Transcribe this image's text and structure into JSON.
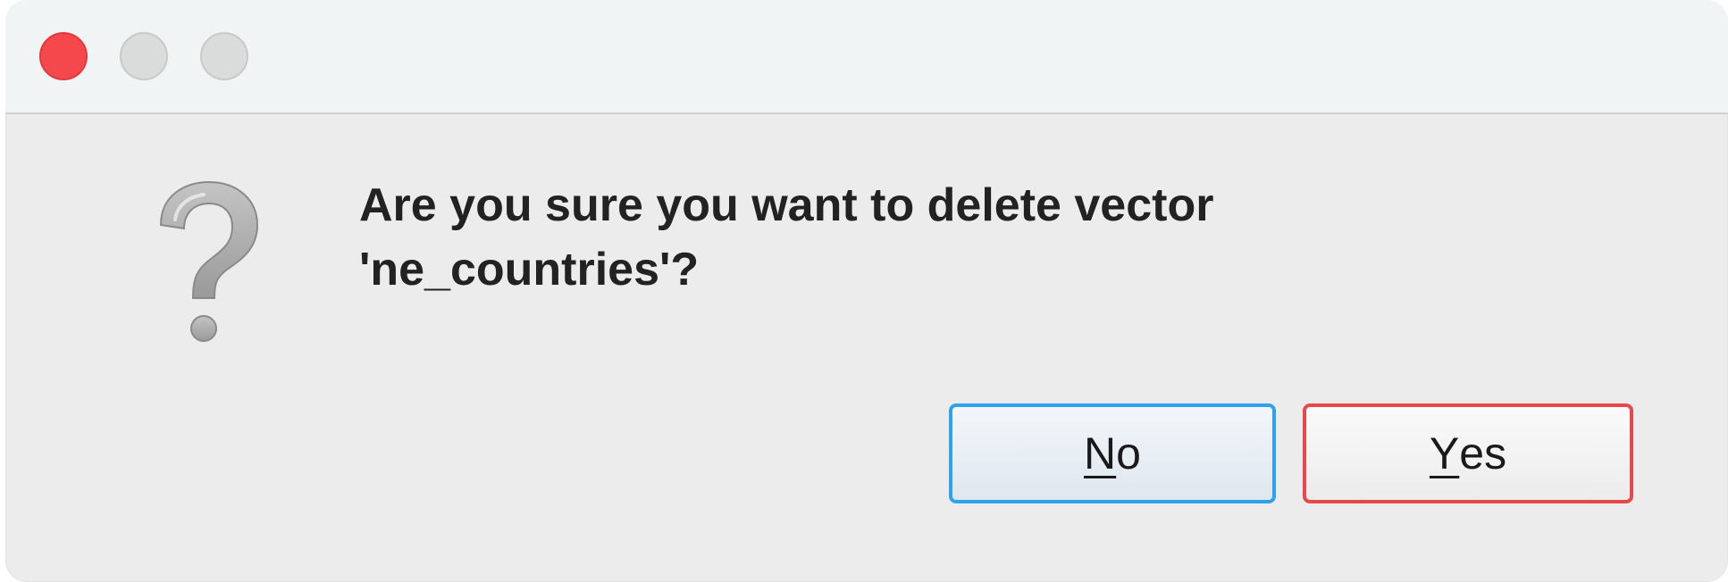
{
  "window": {
    "title": "",
    "controls": {
      "close_icon": "close-traffic-light",
      "minimize_icon": "minimize-traffic-light",
      "zoom_icon": "zoom-traffic-light",
      "close_color": "#f4484d",
      "inactive_color": "#d9dcdb"
    }
  },
  "dialog": {
    "icon": "question-icon",
    "message_line1": "Are you sure you want to delete vector",
    "message_line2": "'ne_countries'?",
    "buttons": {
      "no": {
        "mnemonic": "N",
        "rest": "o",
        "border_color": "#2ea2ec"
      },
      "yes": {
        "mnemonic": "Y",
        "rest": "es",
        "border_color": "#e8474c"
      }
    }
  }
}
